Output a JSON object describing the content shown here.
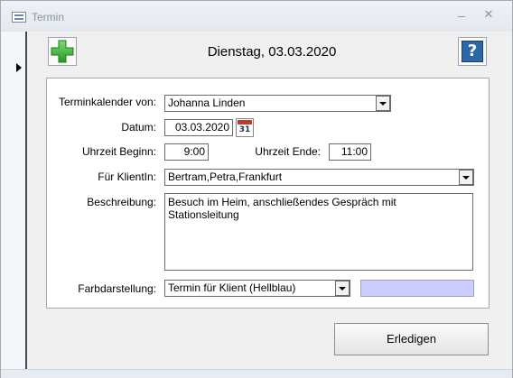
{
  "window": {
    "title": "Termin",
    "minimize_glyph": "–",
    "close_glyph": "✕"
  },
  "header": {
    "date_title": "Dienstag, 03.03.2020",
    "add_icon": "plus-icon",
    "help_icon": "help-icon",
    "help_glyph": "?"
  },
  "form": {
    "calendar_owner": {
      "label": "Terminkalender von:",
      "value": "Johanna Linden"
    },
    "date": {
      "label": "Datum:",
      "value": "03.03.2020",
      "picker_icon": "calendar-icon",
      "picker_day": "31"
    },
    "start_time": {
      "label": "Uhrzeit Beginn:",
      "value": "9:00"
    },
    "end_time": {
      "label": "Uhrzeit Ende:",
      "value": "11:00"
    },
    "client": {
      "label": "Für KlientIn:",
      "value": "Bertram,Petra,Frankfurt"
    },
    "description": {
      "label": "Beschreibung:",
      "value": "Besuch im Heim, anschließendes Gespräch mit Stationsleitung"
    },
    "color": {
      "label": "Farbdarstellung:",
      "value": "Termin für Klient (Hellblau)",
      "swatch_color": "#ccccff"
    }
  },
  "footer": {
    "done_label": "Erledigen"
  },
  "colors": {
    "plus_green": "#3cae3c",
    "help_blue": "#2c68a8",
    "calendar_red": "#c0392b"
  }
}
